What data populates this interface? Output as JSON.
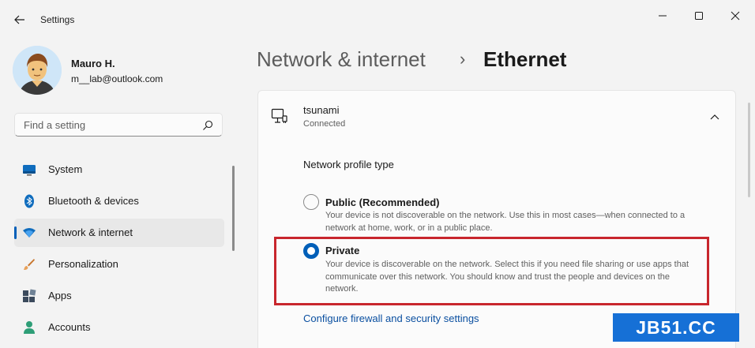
{
  "window": {
    "title": "Settings"
  },
  "user": {
    "name": "Mauro H.",
    "email": "m__lab@outlook.com"
  },
  "search": {
    "placeholder": "Find a setting"
  },
  "sidebar": {
    "items": [
      {
        "label": "System",
        "icon": "system-icon"
      },
      {
        "label": "Bluetooth & devices",
        "icon": "bluetooth-icon"
      },
      {
        "label": "Network & internet",
        "icon": "wifi-icon",
        "selected": true
      },
      {
        "label": "Personalization",
        "icon": "brush-icon"
      },
      {
        "label": "Apps",
        "icon": "apps-icon"
      },
      {
        "label": "Accounts",
        "icon": "person-icon"
      }
    ]
  },
  "breadcrumb": {
    "parent": "Network & internet",
    "separator": "›",
    "current": "Ethernet"
  },
  "connection": {
    "name": "tsunami",
    "status": "Connected"
  },
  "profile": {
    "heading": "Network profile type",
    "options": [
      {
        "title": "Public (Recommended)",
        "description": "Your device is not discoverable on the network. Use this in most cases—when connected to a network at home, work, or in a public place.",
        "selected": false
      },
      {
        "title": "Private",
        "description": "Your device is discoverable on the network. Select this if you need file sharing or use apps that communicate over this network. You should know and trust the people and devices on the network.",
        "selected": true
      }
    ]
  },
  "links": {
    "firewall": "Configure firewall and security settings"
  },
  "watermark": {
    "text": "JB51.CC"
  },
  "colors": {
    "accent": "#005fb8",
    "highlight_border": "#c8262d",
    "watermark_bg": "#1670d6"
  }
}
